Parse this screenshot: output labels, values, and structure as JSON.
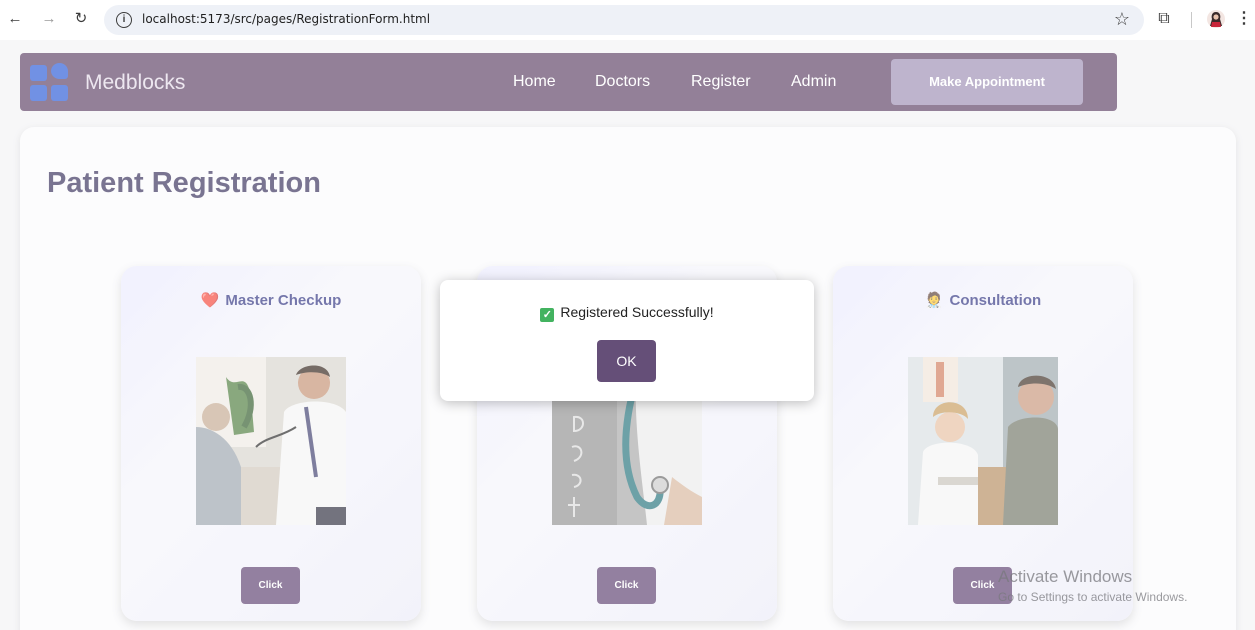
{
  "browser": {
    "url": "localhost:5173/src/pages/RegistrationForm.html",
    "icons": [
      "back-icon",
      "forward-icon",
      "reload-icon",
      "info-icon",
      "star-icon",
      "extensions-icon",
      "profile-icon",
      "menu-icon"
    ]
  },
  "navbar": {
    "brand": "Medblocks",
    "links": [
      "Home",
      "Doctors",
      "Register",
      "Admin"
    ],
    "cta": "Make Appointment"
  },
  "page": {
    "title": "Patient Registration"
  },
  "cards": [
    {
      "title": "Master Checkup",
      "icon": "heart-icon",
      "button": "Click"
    },
    {
      "title": "",
      "icon": "",
      "button": "Click"
    },
    {
      "title": "Consultation",
      "icon": "doctor-icon",
      "button": "Click"
    }
  ],
  "dialog": {
    "message": "Registered Successfully!",
    "ok": "OK"
  },
  "watermark": {
    "title": "Activate Windows",
    "subtitle": "Go to Settings to activate Windows."
  },
  "colors": {
    "navbar": "#5a3d62",
    "logo": "#2557d6",
    "title": "#322a56",
    "card_title": "#2b2f7f",
    "button": "#5a3d6d",
    "ok_button": "#654f78",
    "check": "#43b360"
  }
}
